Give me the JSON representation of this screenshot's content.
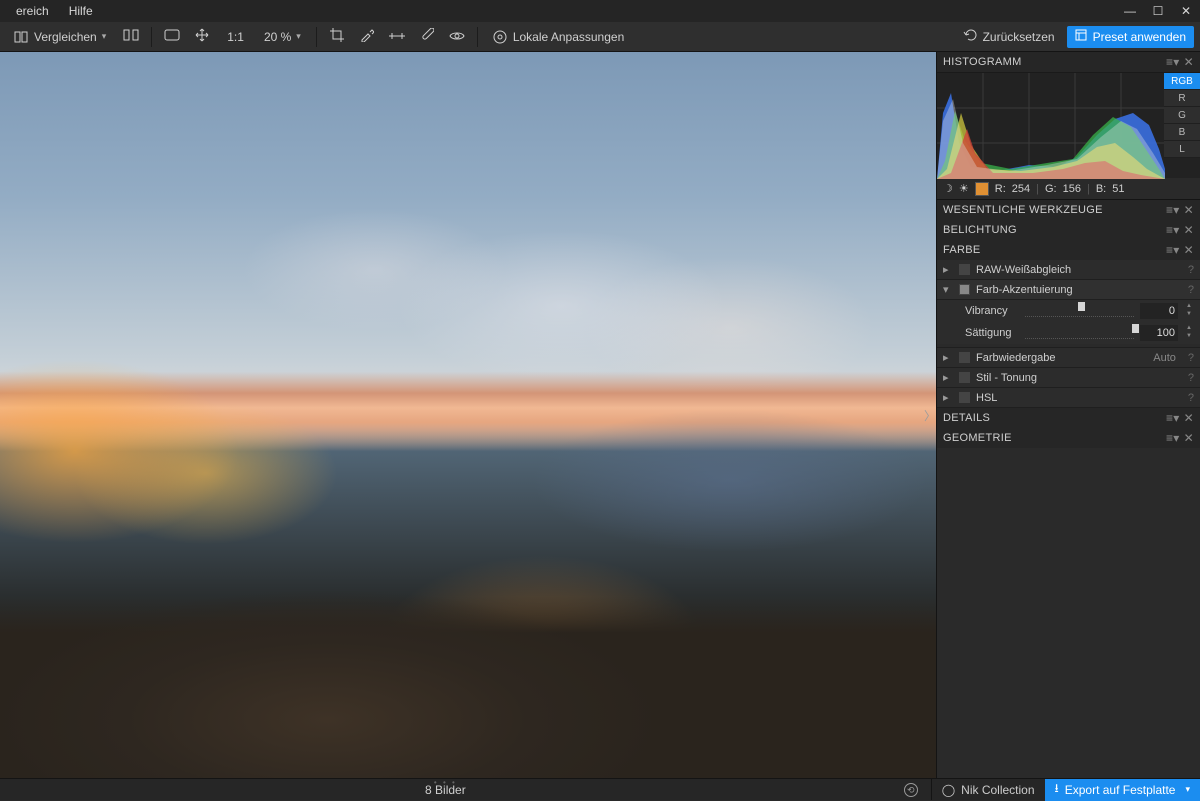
{
  "menu": {
    "bereich": "ereich",
    "hilfe": "Hilfe"
  },
  "window": {
    "min": "—",
    "max": "☐",
    "close": "✕"
  },
  "toolbar": {
    "vergleichen": "Vergleichen",
    "zoom_level": "20 %",
    "one_to_one": "1:1",
    "lokale_anpassungen": "Lokale Anpassungen",
    "zurucksetzen": "Zurücksetzen",
    "preset_anwenden": "Preset anwenden"
  },
  "panels": {
    "histogramm": "HISTOGRAMM",
    "channels": {
      "rgb": "RGB",
      "r": "R",
      "g": "G",
      "b": "B",
      "l": "L"
    },
    "readout": {
      "r_label": "R:",
      "r_val": "254",
      "g_label": "G:",
      "g_val": "156",
      "b_label": "B:",
      "b_val": "51"
    },
    "swatch_color": "#e09033",
    "wesentliche": "WESENTLICHE WERKZEUGE",
    "belichtung": "BELICHTUNG",
    "farbe": "FARBE",
    "raw_weissabgleich": "RAW-Weißabgleich",
    "farb_akzent": "Farb-Akzentuierung",
    "vibrancy": {
      "label": "Vibrancy",
      "value": "0",
      "pos": 49
    },
    "saettigung": {
      "label": "Sättigung",
      "value": "100",
      "pos": 98
    },
    "farbwiedergabe": "Farbwiedergabe",
    "farbwiedergabe_auto": "Auto",
    "stiltonung": "Stil - Tonung",
    "hsl": "HSL",
    "details": "DETAILS",
    "geometrie": "GEOMETRIE"
  },
  "status": {
    "bilder": "8 Bilder",
    "nik": "Nik Collection",
    "export": "Export auf Festplatte"
  }
}
